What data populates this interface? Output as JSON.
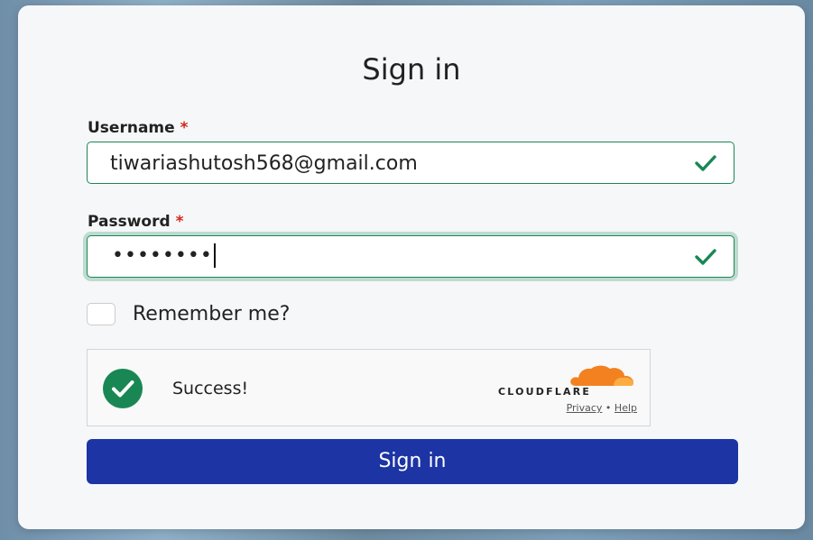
{
  "form": {
    "title": "Sign in",
    "username": {
      "label": "Username",
      "required_mark": "*",
      "value": "tiwariashutosh568@gmail.com",
      "valid": true
    },
    "password": {
      "label": "Password",
      "required_mark": "*",
      "masked_value": "••••••••",
      "valid": true,
      "focused": true
    },
    "remember": {
      "label": "Remember me?",
      "checked": false
    },
    "captcha": {
      "status": "Success!",
      "provider": "CLOUDFLARE",
      "privacy_link": "Privacy",
      "separator": "•",
      "help_link": "Help"
    },
    "submit_label": "Sign in"
  },
  "colors": {
    "valid_green": "#198754",
    "button_blue": "#1d34a4",
    "cloudflare_orange": "#f48120",
    "required_red": "#d0281c"
  }
}
